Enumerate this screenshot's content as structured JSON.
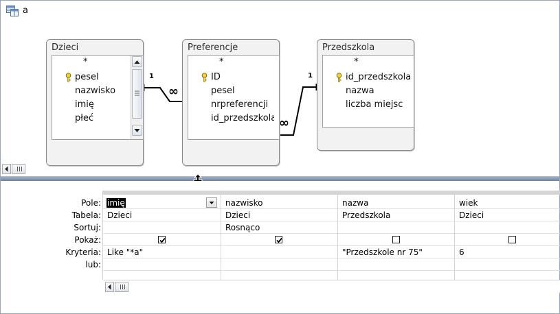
{
  "window": {
    "title": "a"
  },
  "tables": [
    {
      "title": "Dzieci",
      "fields": [
        "*",
        "pesel",
        "nazwisko",
        "imię",
        "płeć"
      ],
      "key_field": "pesel"
    },
    {
      "title": "Preferencje",
      "fields": [
        "*",
        "ID",
        "pesel",
        "nrpreferencji",
        "id_przedszkola"
      ],
      "key_field": "ID"
    },
    {
      "title": "Przedszkola",
      "fields": [
        "*",
        "id_przedszkola",
        "nazwa",
        "liczba miejsc"
      ],
      "key_field": "id_przedszkola"
    }
  ],
  "relations": [
    {
      "from": "Dzieci",
      "to": "Preferencje",
      "from_label": "1",
      "to_label": "∞"
    },
    {
      "from": "Przedszkola",
      "to": "Preferencje",
      "from_label": "1",
      "to_label": "∞"
    }
  ],
  "grid": {
    "row_labels": [
      "Pole:",
      "Tabela:",
      "Sortuj:",
      "Pokaż:",
      "Kryteria:",
      "lub:"
    ],
    "columns": [
      {
        "pole": "imię",
        "tabela": "Dzieci",
        "sortuj": "",
        "pokaz": true,
        "kryteria": "Like \"*a\"",
        "lub": ""
      },
      {
        "pole": "nazwisko",
        "tabela": "Dzieci",
        "sortuj": "Rosnąco",
        "pokaz": true,
        "kryteria": "",
        "lub": ""
      },
      {
        "pole": "nazwa",
        "tabela": "Przedszkola",
        "sortuj": "",
        "pokaz": false,
        "kryteria": "\"Przedszkole nr 75\"",
        "lub": ""
      },
      {
        "pole": "wiek",
        "tabela": "Dzieci",
        "sortuj": "",
        "pokaz": false,
        "kryteria": "6",
        "lub": ""
      }
    ]
  }
}
